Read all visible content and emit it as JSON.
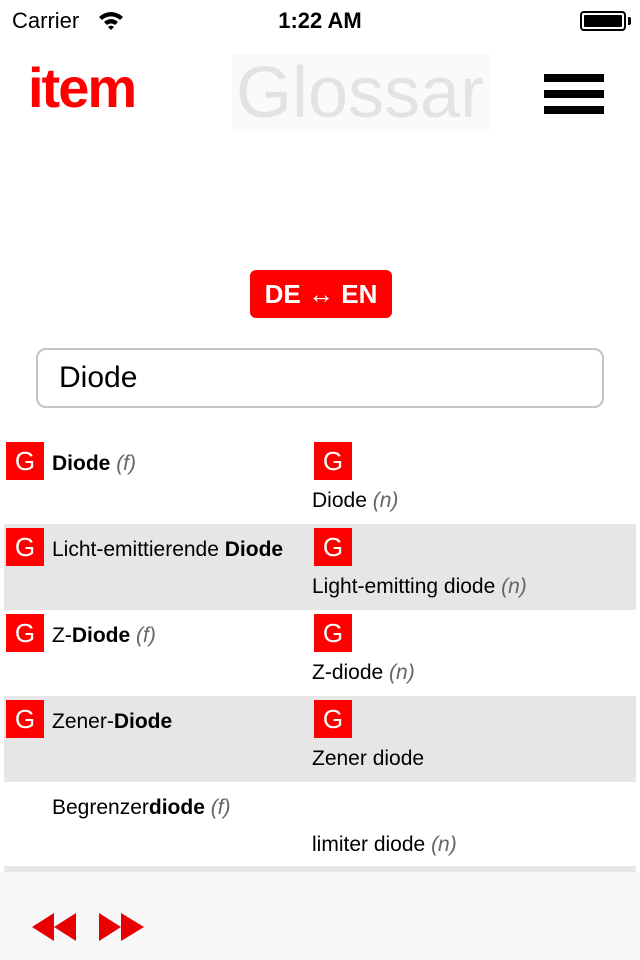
{
  "status_bar": {
    "carrier": "Carrier",
    "time": "1:22 AM",
    "battery_level": 1.0
  },
  "header": {
    "logo": "item",
    "title": "Glossar",
    "menu_icon": "hamburger-menu-icon"
  },
  "language_toggle": {
    "label": "DE ↔ EN"
  },
  "search": {
    "value": "Diode",
    "placeholder": ""
  },
  "colors": {
    "brand_red": "#ff0000",
    "row_alt_bg": "#e6e6e6",
    "toolbar_bg": "#f7f7f7"
  },
  "results": [
    {
      "de_prefix": "",
      "de_bold": "Diode",
      "de_suffix": "",
      "de_gender": "(f)",
      "en": "Diode",
      "en_gender": "(n)",
      "has_g": true,
      "alt": false
    },
    {
      "de_prefix": "Licht-emittierende ",
      "de_bold": "Diode",
      "de_suffix": "",
      "de_gender": "",
      "en": "Light-emitting diode",
      "en_gender": "(n)",
      "has_g": true,
      "alt": true
    },
    {
      "de_prefix": "Z-",
      "de_bold": "Diode",
      "de_suffix": "",
      "de_gender": "(f)",
      "en": "Z-diode",
      "en_gender": "(n)",
      "has_g": true,
      "alt": false
    },
    {
      "de_prefix": "Zener-",
      "de_bold": "Diode",
      "de_suffix": "",
      "de_gender": "",
      "en": "Zener diode",
      "en_gender": "",
      "has_g": true,
      "alt": true
    },
    {
      "de_prefix": "Begrenzer",
      "de_bold": "diode",
      "de_suffix": "",
      "de_gender": "(f)",
      "en": "limiter diode",
      "en_gender": "(n)",
      "has_g": false,
      "alt": false
    }
  ],
  "badge_label": "G",
  "toolbar": {
    "prev_icon": "rewind-icon",
    "next_icon": "fast-forward-icon"
  }
}
